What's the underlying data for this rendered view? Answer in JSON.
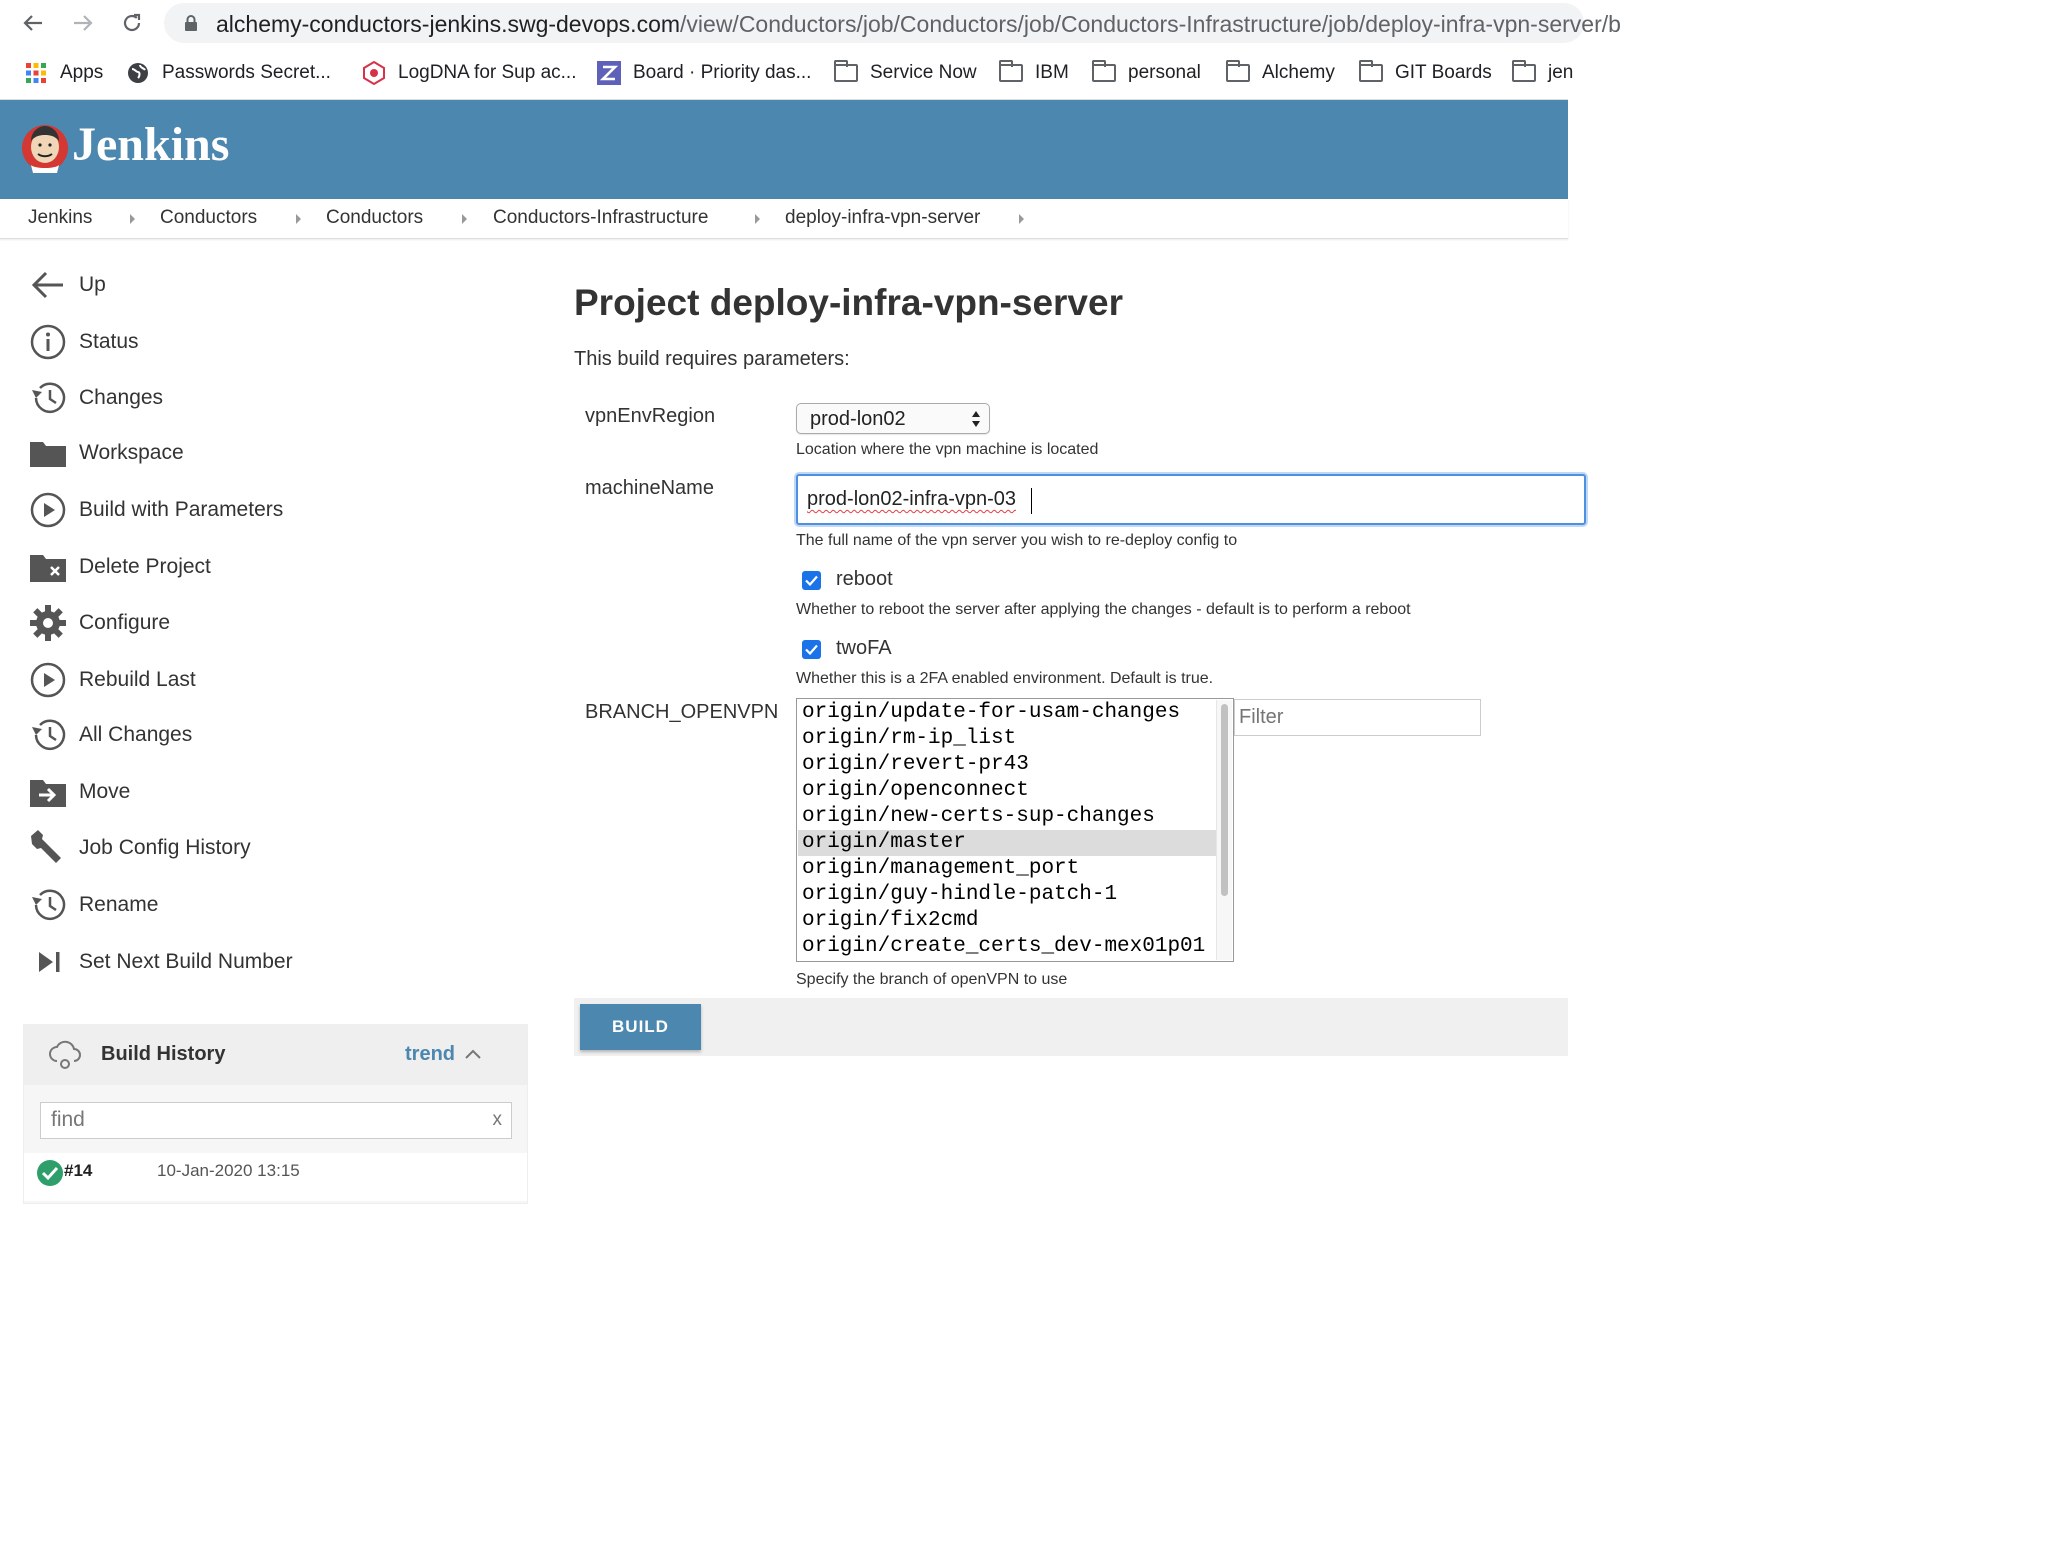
{
  "browser": {
    "url_domain": "alchemy-conductors-jenkins.swg-devops.com",
    "url_path": "/view/Conductors/job/Conductors/job/Conductors-Infrastructure/job/deploy-infra-vpn-server/b",
    "bookmarks": [
      {
        "label": "Apps",
        "icon": "apps-grid-icon"
      },
      {
        "label": "Passwords Secret...",
        "icon": "globe-icon"
      },
      {
        "label": "LogDNA for Sup ac...",
        "icon": "logdna-icon"
      },
      {
        "label": "Board · Priority das...",
        "icon": "zenhub-icon"
      },
      {
        "label": "Service Now",
        "icon": "folder-icon"
      },
      {
        "label": "IBM",
        "icon": "folder-icon"
      },
      {
        "label": "personal",
        "icon": "folder-icon"
      },
      {
        "label": "Alchemy",
        "icon": "folder-icon"
      },
      {
        "label": "GIT Boards",
        "icon": "folder-icon"
      },
      {
        "label": "jen",
        "icon": "folder-icon"
      }
    ]
  },
  "header": {
    "title": "Jenkins"
  },
  "breadcrumbs": [
    "Jenkins",
    "Conductors",
    "Conductors",
    "Conductors-Infrastructure",
    "deploy-infra-vpn-server"
  ],
  "sidebar": {
    "tasks": [
      {
        "label": "Up",
        "icon": "arrow-left-icon"
      },
      {
        "label": "Status",
        "icon": "info-icon"
      },
      {
        "label": "Changes",
        "icon": "history-icon"
      },
      {
        "label": "Workspace",
        "icon": "folder-icon"
      },
      {
        "label": "Build with Parameters",
        "icon": "play-icon"
      },
      {
        "label": "Delete Project",
        "icon": "folder-delete-icon"
      },
      {
        "label": "Configure",
        "icon": "gear-icon"
      },
      {
        "label": "Rebuild Last",
        "icon": "play-icon"
      },
      {
        "label": "All Changes",
        "icon": "history-icon"
      },
      {
        "label": "Move",
        "icon": "folder-move-icon"
      },
      {
        "label": "Job Config History",
        "icon": "wrench-icon"
      },
      {
        "label": "Rename",
        "icon": "history-icon"
      },
      {
        "label": "Set Next Build Number",
        "icon": "skip-next-icon"
      }
    ]
  },
  "build_history": {
    "title": "Build History",
    "trend_label": "trend",
    "find_value": "find",
    "clear_label": "x",
    "builds": [
      {
        "number": "#14",
        "date": "10-Jan-2020 13:15",
        "status_color": "#2e9e6b"
      }
    ]
  },
  "main": {
    "title": "Project deploy-infra-vpn-server",
    "requires": "This build requires parameters:",
    "params": {
      "vpnEnvRegion": {
        "label": "vpnEnvRegion",
        "value": "prod-lon02",
        "description": "Location where the vpn machine is located"
      },
      "machineName": {
        "label": "machineName",
        "value": "prod-lon02-infra-vpn-03",
        "description": "The full name of the vpn server you wish to re-deploy config to"
      },
      "reboot": {
        "label": "reboot",
        "checked": true,
        "description": "Whether to reboot the server after applying the changes - default is to perform a reboot"
      },
      "twoFA": {
        "label": "twoFA",
        "checked": true,
        "description": "Whether this is a 2FA enabled environment. Default is true."
      },
      "branch": {
        "label": "BRANCH_OPENVPN",
        "options": [
          "origin/update-for-usam-changes",
          "origin/rm-ip_list",
          "origin/revert-pr43",
          "origin/openconnect",
          "origin/new-certs-sup-changes",
          "origin/master",
          "origin/management_port",
          "origin/guy-hindle-patch-1",
          "origin/fix2cmd",
          "origin/create_certs_dev-mex01p01"
        ],
        "selected": "origin/master",
        "filter_placeholder": "Filter",
        "description": "Specify the branch of openVPN to use"
      }
    },
    "build_button": "BUILD"
  },
  "colors": {
    "jenkins_blue": "#4c87b0",
    "checkbox_blue": "#1a73e8",
    "focus_ring": "#4d8fe0"
  }
}
